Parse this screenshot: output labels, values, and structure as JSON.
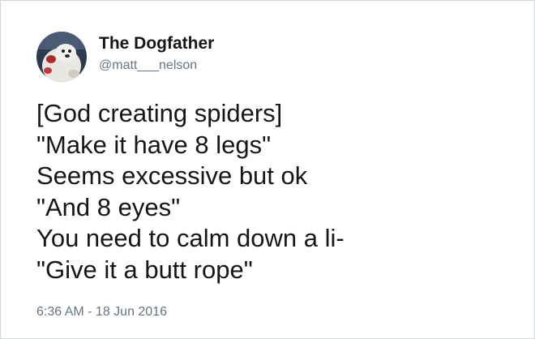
{
  "tweet": {
    "author": {
      "display_name": "The Dogfather",
      "handle": "@matt___nelson",
      "avatar_icon": "profile-photo-dog"
    },
    "text_lines": [
      "[God creating spiders]",
      "\"Make it have 8 legs\"",
      "Seems excessive but ok",
      "\"And 8 eyes\"",
      "You need to calm down a li-",
      "\"Give it a butt rope\""
    ],
    "timestamp": "6:36 AM - 18 Jun 2016"
  },
  "colors": {
    "text": "#14171a",
    "secondary_text": "#66757f",
    "border": "#cfd6dc"
  }
}
